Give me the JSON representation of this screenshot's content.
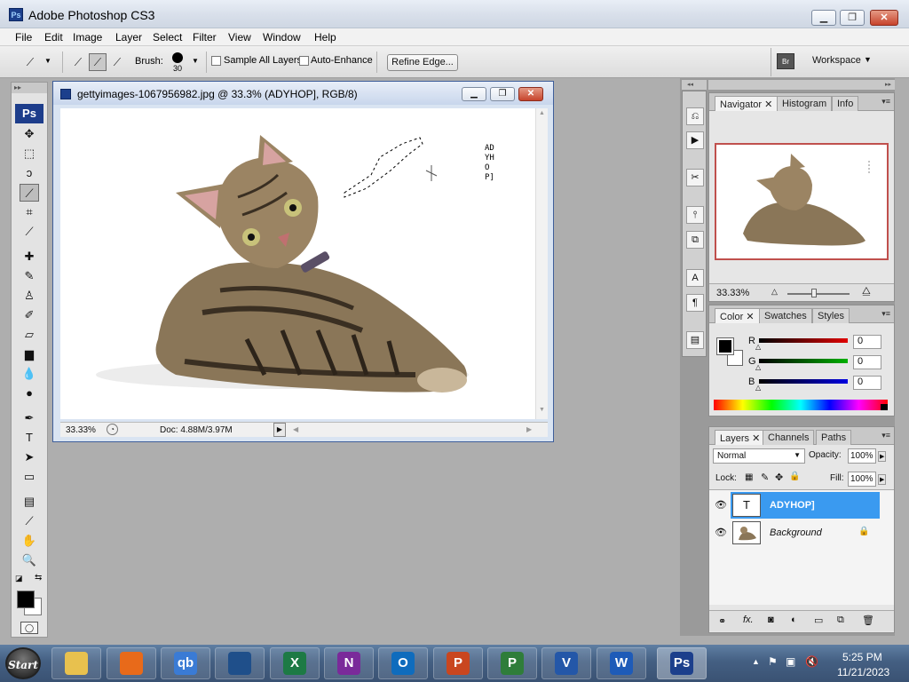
{
  "app": {
    "title": "Adobe Photoshop CS3",
    "icon_text": "Ps"
  },
  "menu": [
    "File",
    "Edit",
    "Image",
    "Layer",
    "Select",
    "Filter",
    "View",
    "Window",
    "Help"
  ],
  "options": {
    "brush_label": "Brush:",
    "brush_size": "30",
    "sample_all_layers": "Sample All Layers",
    "auto_enhance": "Auto-Enhance",
    "refine_edge": "Refine Edge...",
    "workspace": "Workspace"
  },
  "toolbox": {
    "logo": "Ps"
  },
  "document": {
    "title": "gettyimages-1067956982.jpg @ 33.3% (ADYHOP], RGB/8)",
    "zoom": "33.33%",
    "doc_size": "Doc: 4.88M/3.97M",
    "vertical_text": "ADYHOP]"
  },
  "navigator": {
    "tabs": [
      "Navigator",
      "Histogram",
      "Info"
    ],
    "zoom": "33.33%"
  },
  "color": {
    "tabs": [
      "Color",
      "Swatches",
      "Styles"
    ],
    "channels": [
      {
        "label": "R",
        "value": "0",
        "color": "#d00000"
      },
      {
        "label": "G",
        "value": "0",
        "color": "#00a000"
      },
      {
        "label": "B",
        "value": "0",
        "color": "#0000c8"
      }
    ]
  },
  "layers": {
    "tabs": [
      "Layers",
      "Channels",
      "Paths"
    ],
    "blend_mode": "Normal",
    "opacity_label": "Opacity:",
    "opacity": "100%",
    "lock_label": "Lock:",
    "fill_label": "Fill:",
    "fill": "100%",
    "items": [
      {
        "name": "ADYHOP]",
        "thumb": "T",
        "selected": true
      },
      {
        "name": "Background",
        "thumb": "",
        "selected": false
      }
    ]
  },
  "taskbar": {
    "start": "Start",
    "apps": [
      {
        "name": "file-explorer",
        "label": "",
        "color": "#e8c14e"
      },
      {
        "name": "firefox",
        "label": "",
        "color": "#e86a1a"
      },
      {
        "name": "qbittorrent",
        "label": "qb",
        "color": "#3a7bd5"
      },
      {
        "name": "remote-desktop",
        "label": "",
        "color": "#1f4f8a"
      },
      {
        "name": "excel",
        "label": "X",
        "color": "#1d7a45"
      },
      {
        "name": "onenote",
        "label": "N",
        "color": "#7a2a9a"
      },
      {
        "name": "outlook",
        "label": "O",
        "color": "#0f6cbd"
      },
      {
        "name": "powerpoint",
        "label": "P",
        "color": "#c9461f"
      },
      {
        "name": "project",
        "label": "P",
        "color": "#2f7d3a"
      },
      {
        "name": "visio",
        "label": "V",
        "color": "#2457a8"
      },
      {
        "name": "word",
        "label": "W",
        "color": "#1e5bb8"
      },
      {
        "name": "photoshop",
        "label": "Ps",
        "color": "#1c3f8c"
      }
    ],
    "time": "5:25 PM",
    "date": "11/21/2023"
  }
}
